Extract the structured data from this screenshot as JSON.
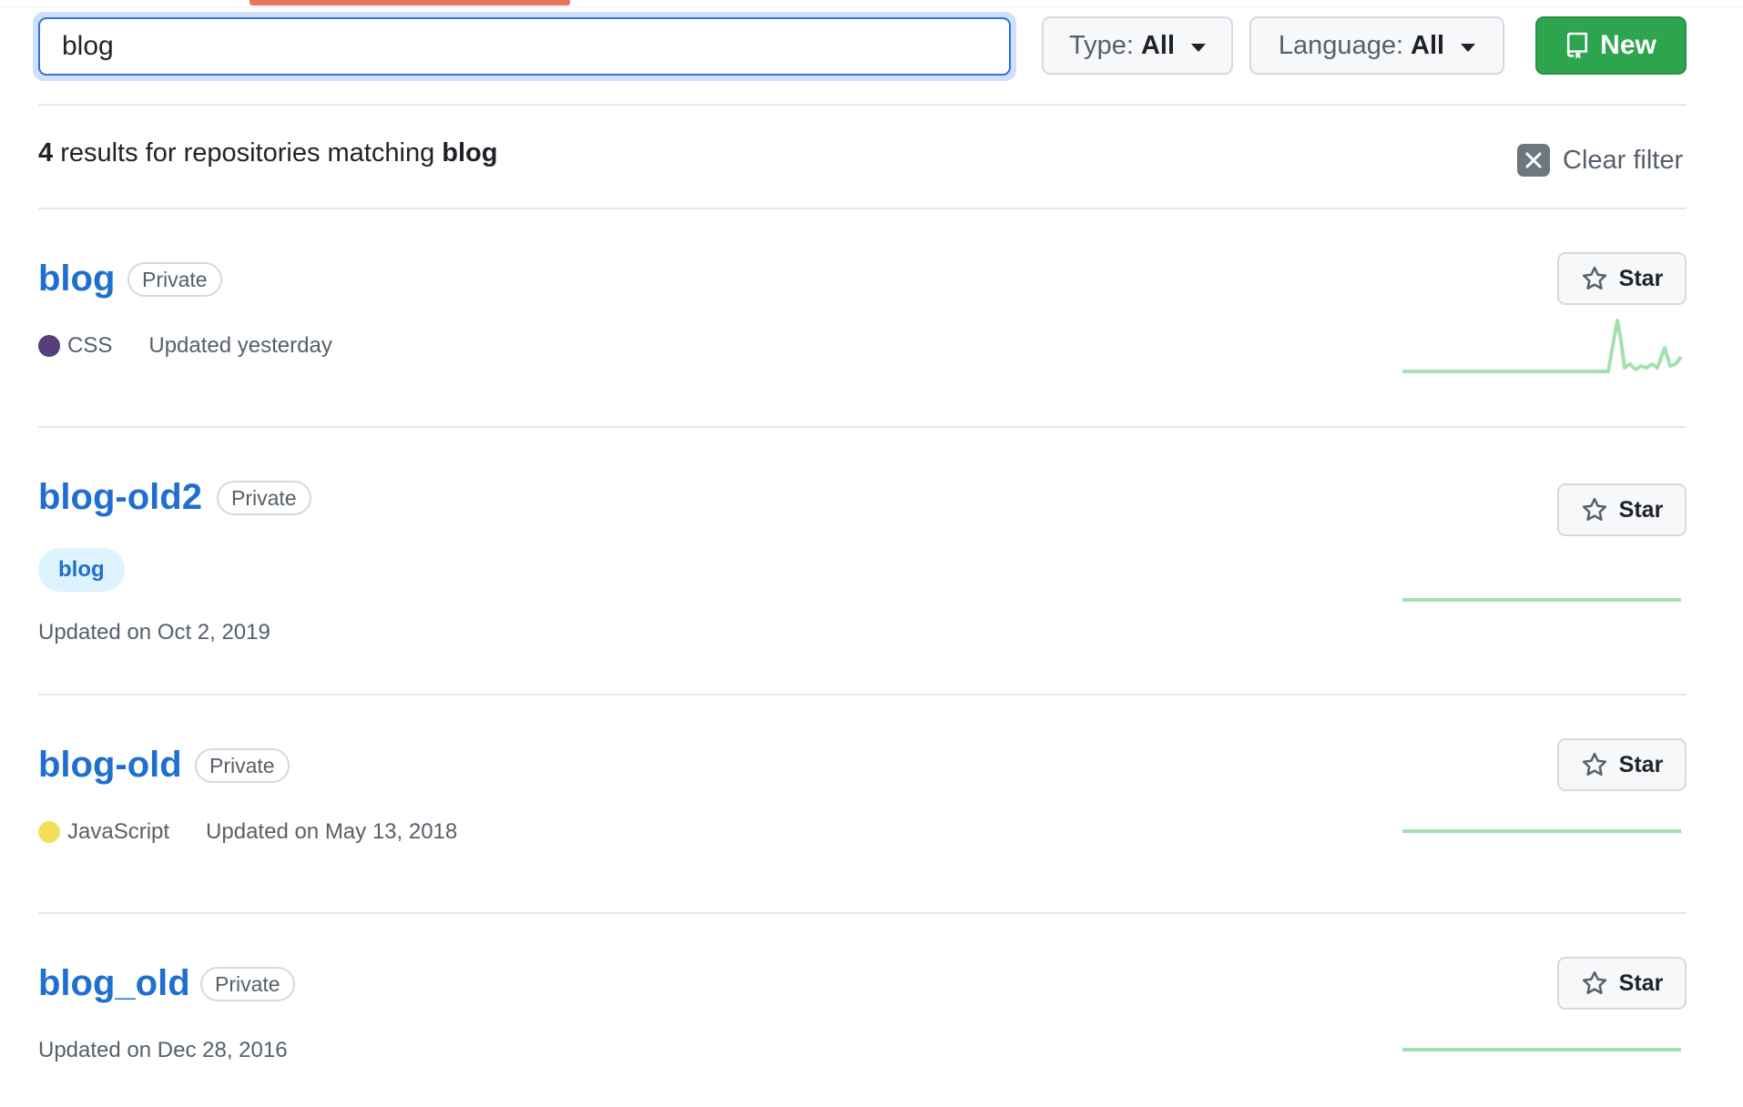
{
  "search": {
    "value": "blog"
  },
  "filters": {
    "type_prefix": "Type:",
    "type_value": "All",
    "language_prefix": "Language:",
    "language_value": "All"
  },
  "new_button": {
    "label": "New",
    "icon": "repo-icon"
  },
  "results": {
    "count": "4",
    "text": " results for repositories matching ",
    "query": "blog",
    "clear_label": "Clear filter"
  },
  "repos": [
    {
      "name": "blog",
      "visibility": "Private",
      "language": "CSS",
      "language_color": "#563d7c",
      "updated": "Updated yesterday",
      "topics": [],
      "star_label": "Star"
    },
    {
      "name": "blog-old2",
      "visibility": "Private",
      "language": "",
      "language_color": "",
      "updated": "Updated on Oct 2, 2019",
      "topics": [
        "blog"
      ],
      "star_label": "Star"
    },
    {
      "name": "blog-old",
      "visibility": "Private",
      "language": "JavaScript",
      "language_color": "#f1e05a",
      "updated": "Updated on May 13, 2018",
      "topics": [],
      "star_label": "Star"
    },
    {
      "name": "blog_old",
      "visibility": "Private",
      "language": "",
      "language_color": "",
      "updated": "Updated on Dec 28, 2016",
      "topics": [],
      "star_label": "Star"
    }
  ],
  "colors": {
    "link": "#1f6fd1",
    "primary_button": "#2da44e",
    "focus": "#2f6ee5",
    "sparkline": "#a4e1b0"
  }
}
